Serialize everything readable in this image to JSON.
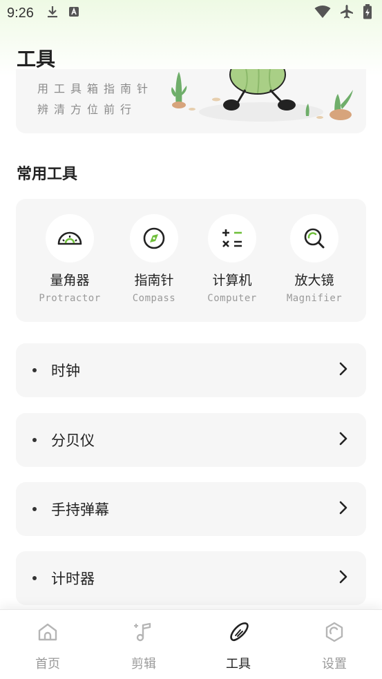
{
  "status_bar": {
    "time": "9:26"
  },
  "header": {
    "title": "工具"
  },
  "banner": {
    "line1": "用工具箱指南针",
    "line2": "辨清方位前行"
  },
  "section": {
    "title": "常用工具"
  },
  "tools": [
    {
      "name": "量角器",
      "en": "Protractor",
      "icon": "protractor-icon"
    },
    {
      "name": "指南针",
      "en": "Compass",
      "icon": "compass-icon"
    },
    {
      "name": "计算机",
      "en": "Computer",
      "icon": "calculator-icon"
    },
    {
      "name": "放大镜",
      "en": "Magnifier",
      "icon": "magnifier-icon"
    }
  ],
  "list": [
    {
      "label": "时钟"
    },
    {
      "label": "分贝仪"
    },
    {
      "label": "手持弹幕"
    },
    {
      "label": "计时器"
    }
  ],
  "nav": [
    {
      "label": "首页",
      "icon": "home-icon"
    },
    {
      "label": "剪辑",
      "icon": "music-note-icon"
    },
    {
      "label": "工具",
      "icon": "cucumber-icon",
      "active": true
    },
    {
      "label": "设置",
      "icon": "settings-icon"
    }
  ],
  "colors": {
    "accent": "#6fbf3a",
    "text": "#222222",
    "muted": "#9a9a9a",
    "card": "#f6f6f6"
  }
}
